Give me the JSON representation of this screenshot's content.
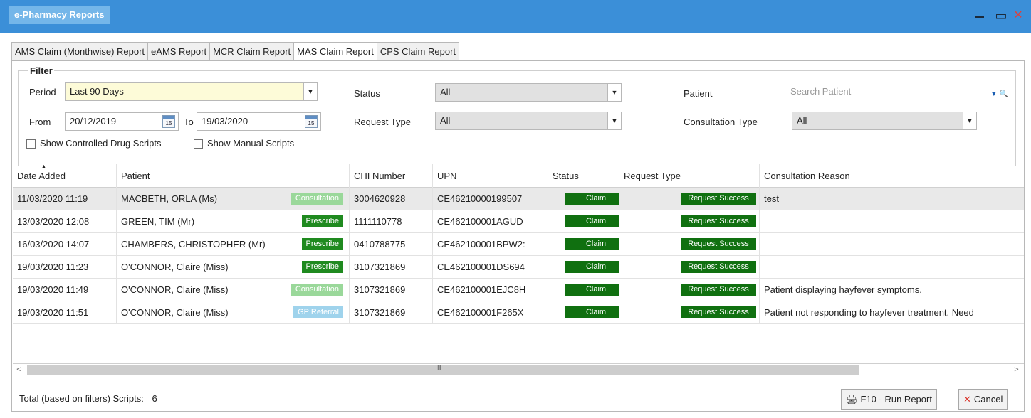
{
  "window": {
    "title": "e-Pharmacy Reports",
    "controls": {
      "minimize": "▬",
      "maximize": "▭",
      "close": "✕"
    }
  },
  "tabs": [
    {
      "label": "AMS Claim (Monthwise) Report",
      "active": false
    },
    {
      "label": "eAMS Report",
      "active": false
    },
    {
      "label": "MCR Claim Report",
      "active": false
    },
    {
      "label": "MAS Claim Report",
      "active": true
    },
    {
      "label": "CPS Claim Report",
      "active": false
    }
  ],
  "filter": {
    "legend": "Filter",
    "period_label": "Period",
    "period_value": "Last 90 Days",
    "from_label": "From",
    "from_value": "20/12/2019",
    "to_label": "To",
    "to_value": "19/03/2020",
    "calendar_day": "15",
    "status_label": "Status",
    "status_value": "All",
    "request_type_label": "Request Type",
    "request_type_value": "All",
    "patient_label": "Patient",
    "patient_placeholder": "Search Patient",
    "consultation_type_label": "Consultation Type",
    "consultation_type_value": "All",
    "show_controlled": "Show Controlled Drug Scripts",
    "show_manual": "Show Manual Scripts"
  },
  "table": {
    "columns": [
      "Date Added",
      "Patient",
      "CHI Number",
      "UPN",
      "Status",
      "Request Type",
      "Consultation Reason"
    ],
    "rows": [
      {
        "date": "11/03/2020 11:19",
        "patient": "MACBETH, ORLA (Ms)",
        "tag": "Consultation",
        "tag_type": "consult",
        "chi": "3004620928",
        "upn": "CE46210000199507",
        "status": "Claim",
        "request": "Request Success",
        "reason": "test"
      },
      {
        "date": "13/03/2020 12:08",
        "patient": "GREEN, TIM (Mr)",
        "tag": "Prescribe",
        "tag_type": "prescribe",
        "chi": "1111110778",
        "upn": "CE462100001AGUD",
        "status": "Claim",
        "request": "Request Success",
        "reason": ""
      },
      {
        "date": "16/03/2020 14:07",
        "patient": "CHAMBERS, CHRISTOPHER (Mr)",
        "tag": "Prescribe",
        "tag_type": "prescribe",
        "chi": "0410788775",
        "upn": "CE462100001BPW2:",
        "status": "Claim",
        "request": "Request Success",
        "reason": ""
      },
      {
        "date": "19/03/2020 11:23",
        "patient": "O'CONNOR, Claire (Miss)",
        "tag": "Prescribe",
        "tag_type": "prescribe",
        "chi": "3107321869",
        "upn": "CE462100001DS694",
        "status": "Claim",
        "request": "Request Success",
        "reason": ""
      },
      {
        "date": "19/03/2020 11:49",
        "patient": "O'CONNOR, Claire (Miss)",
        "tag": "Consultation",
        "tag_type": "consult",
        "chi": "3107321869",
        "upn": "CE462100001EJC8H",
        "status": "Claim",
        "request": "Request Success",
        "reason": "Patient displaying hayfever symptoms."
      },
      {
        "date": "19/03/2020 11:51",
        "patient": "O'CONNOR, Claire (Miss)",
        "tag": "GP Referral",
        "tag_type": "referral",
        "chi": "3107321869",
        "upn": "CE462100001F265X",
        "status": "Claim",
        "request": "Request Success",
        "reason": "Patient not responding to hayfever treatment. Need"
      }
    ]
  },
  "scrollbar": {
    "left": "<",
    "right": ">",
    "grip": "III"
  },
  "footer": {
    "total_text": "Total (based on filters) Scripts:",
    "total_count": "6",
    "run_label": "F10 - Run Report",
    "cancel_label": "Cancel"
  },
  "colors": {
    "titlebar": "#3b8fd8",
    "prescribe": "#1f8a1f",
    "consultation": "#9ad89a",
    "gp_referral": "#9fd3ec",
    "status_badge": "#107010",
    "cancel_icon": "#d9342b"
  },
  "icons": [
    "minimize-icon",
    "maximize-icon",
    "close-icon",
    "dropdown-arrow-icon",
    "calendar-icon",
    "search-icon",
    "printer-icon",
    "cancel-x-icon",
    "sort-up-icon"
  ]
}
